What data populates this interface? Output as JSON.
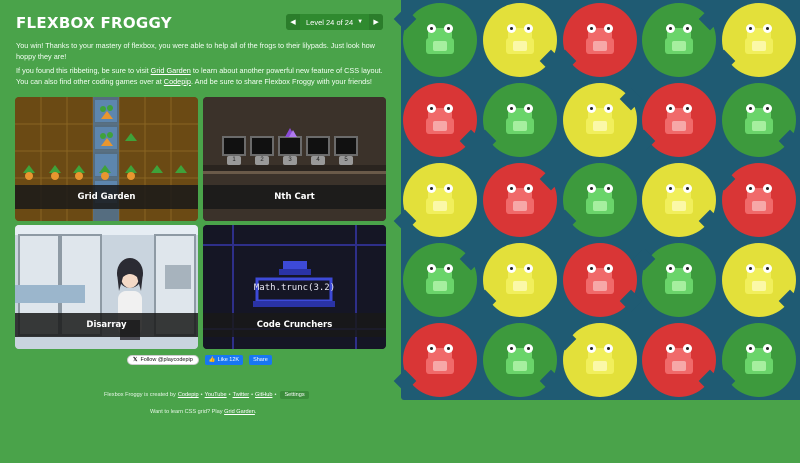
{
  "header": {
    "title": "FLEXBOX FROGGY",
    "level_text": "Level 24 of 24",
    "prev_icon": "triangle-left-icon",
    "next_icon": "triangle-right-icon",
    "caret_icon": "caret-down-icon"
  },
  "intro": {
    "p1": "You win! Thanks to your mastery of flexbox, you were able to help all of the frogs to their lilypads. Just look how hoppy they are!",
    "p2_a": "If you found this ribbeting, be sure to visit ",
    "p2_link1": "Grid Garden",
    "p2_b": " to learn about another powerful new feature of CSS layout. You can also find other coding games over at ",
    "p2_link2": "Codepip",
    "p2_c": ". And be sure to share Flexbox Froggy with your friends!"
  },
  "games": [
    {
      "label": "Grid Garden"
    },
    {
      "label": "Nth Cart"
    },
    {
      "label": "Disarray"
    },
    {
      "label": "Code Crunchers"
    }
  ],
  "nth_cart_numbers": [
    "1",
    "2",
    "3",
    "4",
    "5"
  ],
  "code_crunchers_expr": "Math.trunc(3.2)",
  "social": {
    "twitter": "Follow @playcodepip",
    "fb_like": "Like 12K",
    "fb_share": "Share"
  },
  "footer": {
    "created_by": "Flexbox Froggy is created by",
    "codepip": "Codepip",
    "sep": "•",
    "youtube": "YouTube",
    "twitter": "Twitter",
    "github": "GitHub",
    "settings": "Settings",
    "grid_prompt": "Want to learn CSS grid? Play",
    "grid_link": "Grid Garden",
    "grid_end": "."
  },
  "pond": {
    "colors": {
      "green": {
        "pad": "#3d9a3d",
        "frog": "#6ad46a",
        "dark": "#4fb84f",
        "belly": "#a6ef9f"
      },
      "red": {
        "pad": "#d93636",
        "frog": "#f06a6a",
        "dark": "#d84e4e",
        "belly": "#f6a8a8"
      },
      "yellow": {
        "pad": "#e3e03a",
        "frog": "#f1ef5c",
        "dark": "#d9d83f",
        "belly": "#fbf8a8"
      }
    },
    "rows": [
      [
        "green",
        "yellow",
        "red",
        "green",
        "yellow"
      ],
      [
        "red",
        "green",
        "yellow",
        "red",
        "green"
      ],
      [
        "yellow",
        "red",
        "green",
        "yellow",
        "red"
      ],
      [
        "green",
        "yellow",
        "red",
        "green",
        "yellow"
      ],
      [
        "red",
        "green",
        "yellow",
        "red",
        "green"
      ]
    ]
  }
}
